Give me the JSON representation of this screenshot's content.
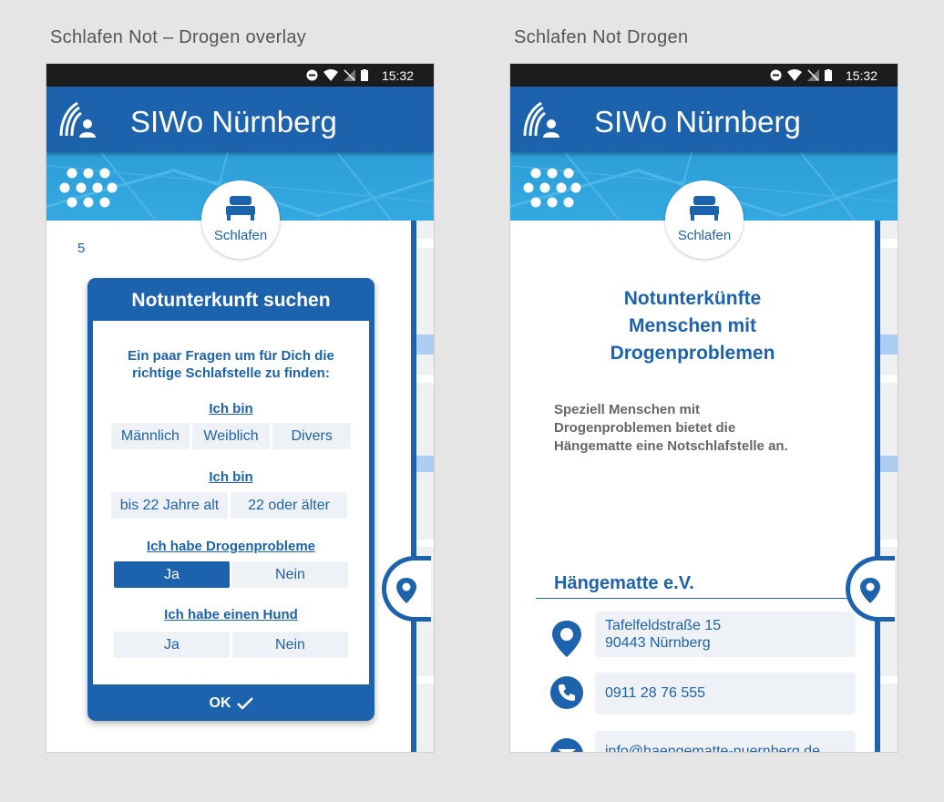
{
  "labels": {
    "left": "Schlafen Not – Drogen  overlay",
    "right": "Schlafen Not Drogen"
  },
  "status_bar": {
    "time": "15:32"
  },
  "app": {
    "title": "SIWo Nürnberg"
  },
  "category": {
    "label": "Schlafen",
    "icon": "bed-icon"
  },
  "left_screen": {
    "counter": "5",
    "dialog": {
      "title": "Notunterkunft suchen",
      "intro_line1": "Ein paar Fragen um für Dich die",
      "intro_line2": "richtige Schlafstelle zu finden:",
      "q1": {
        "label": "Ich bin",
        "options": [
          "Männlich",
          "Weiblich",
          "Divers"
        ]
      },
      "q2": {
        "label": "Ich bin",
        "options": [
          "bis 22 Jahre alt",
          "22 oder älter"
        ]
      },
      "q3": {
        "label": "Ich habe Drogenprobleme",
        "options": [
          "Ja",
          "Nein"
        ],
        "selected": "Ja"
      },
      "q4": {
        "label": "Ich habe einen Hund",
        "options": [
          "Ja",
          "Nein"
        ]
      },
      "ok_label": "OK"
    }
  },
  "right_screen": {
    "title_line1": "Notunterkünfte",
    "title_line2": "Menschen mit",
    "title_line3": "Drogenproblemen",
    "desc_line1": "Speziell Menschen mit",
    "desc_line2": "Drogenproblemen bietet die",
    "desc_line3": "Hängematte eine Notschlafstelle an.",
    "org_name": "Hängematte e.V.",
    "address_line1": "Tafelfeldstraße 15",
    "address_line2": "90443 Nürnberg",
    "phone": "0911  28 76 555",
    "email": "info@haengematte-nuernberg.de"
  },
  "colors": {
    "primary": "#1d62ad",
    "accent": "#2c9ed8",
    "chip": "#eef1f5"
  }
}
